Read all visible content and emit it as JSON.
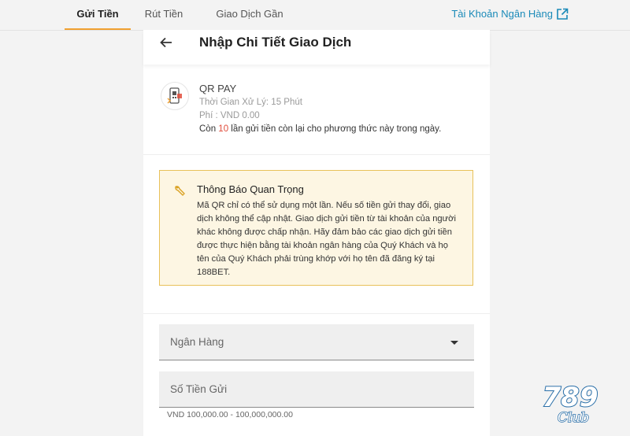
{
  "tabs": {
    "deposit": "Gửi Tiền",
    "withdraw": "Rút Tiền",
    "history": "Giao Dịch Gần Đây",
    "active": "deposit"
  },
  "bank_account_link": "Tài Khoản Ngân Hàng",
  "header": {
    "title": "Nhập Chi Tiết Giao Dịch"
  },
  "method": {
    "name": "QR PAY",
    "processing_time": "Thời Gian Xử Lý: 15 Phút",
    "fee": "Phí : VND 0.00",
    "remaining_prefix": "Còn ",
    "remaining_count": "10",
    "remaining_suffix": " lần gửi tiền còn lại cho phương thức này trong ngày."
  },
  "notice": {
    "title": "Thông Báo Quan Trọng",
    "body": "Mã QR chỉ có thể sử dụng một lần. Nếu số tiền gửi thay đổi, giao dịch không thể cập nhật. Giao dịch gửi tiền từ tài khoản của người khác không được chấp nhận. Hãy đảm bảo các giao dịch gửi tiền được thực hiện bằng tài khoản ngân hàng của Quý Khách và họ tên của Quý Khách phải trùng khớp với họ tên đã đăng ký tại 188BET."
  },
  "form": {
    "bank_label": "Ngân Hàng",
    "amount_label": "Số Tiền Gửi",
    "amount_hint": "VND 100,000.00 - 100,000,000.00"
  },
  "logo": {
    "text_top": "789",
    "text_bottom": "Club"
  },
  "colors": {
    "accent": "#f0a030",
    "link": "#1a8ab8",
    "highlight": "#e04b3a",
    "notice_bg": "#fdf6e3",
    "notice_border": "#e8c15a"
  },
  "icons": {
    "back": "arrow-left-icon",
    "external": "external-link-icon",
    "method": "qr-phone-icon",
    "notice": "wrench-icon",
    "dropdown": "caret-down-icon"
  }
}
